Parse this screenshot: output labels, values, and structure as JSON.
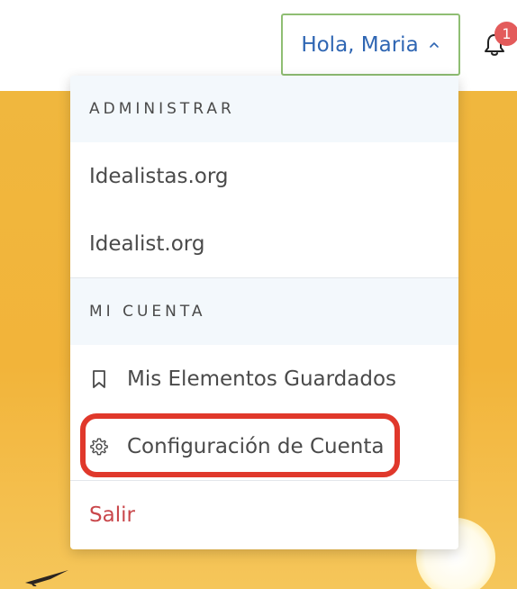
{
  "header": {
    "greeting": "Hola, Maria",
    "notification_count": "1"
  },
  "menu": {
    "sections": [
      {
        "heading": "ADMINISTRAR",
        "items": [
          "Idealistas.org",
          "Idealist.org"
        ]
      },
      {
        "heading": "MI CUENTA",
        "items": [
          "Mis Elementos Guardados",
          "Configuración de Cuenta"
        ]
      }
    ],
    "logout_label": "Salir"
  },
  "colors": {
    "accent_blue": "#2f66b3",
    "button_border": "#8fbe73",
    "logout_red": "#c9474b",
    "badge_red": "#e35b5b",
    "highlight_red": "#e0382b",
    "hero_orange": "#f0b73e"
  },
  "icons": {
    "user_button": "chevron-up-icon",
    "notifications": "bell-icon",
    "saved_items": "bookmark-icon",
    "account_settings": "gear-icon"
  }
}
